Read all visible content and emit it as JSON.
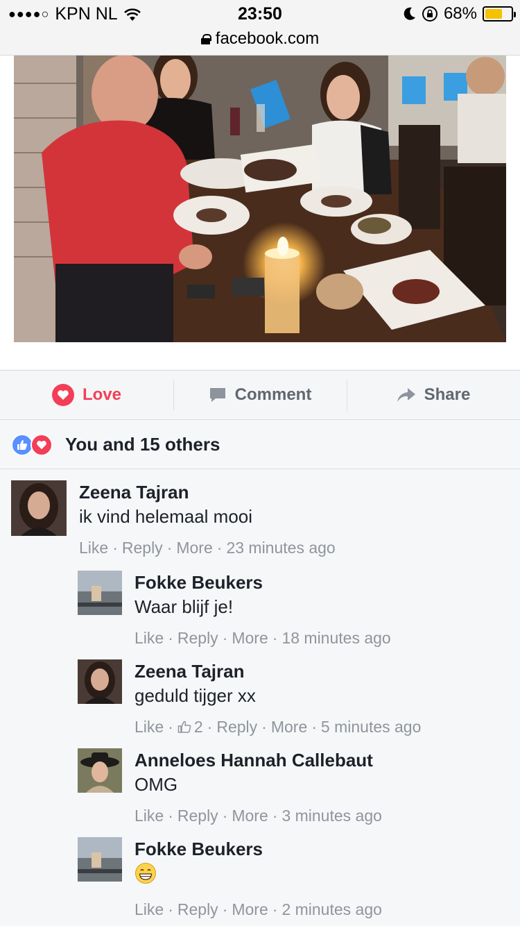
{
  "status_bar": {
    "signal": "●●●●○",
    "carrier": "KPN NL",
    "time": "23:50",
    "battery_percent": "68%",
    "battery_level": 0.68,
    "url": "facebook.com"
  },
  "actions": {
    "love_label": "Love",
    "comment_label": "Comment",
    "share_label": "Share"
  },
  "reactions": {
    "summary": "You and 15 others"
  },
  "comments": [
    {
      "name": "Zeena Tajran",
      "text": "ik vind helemaal mooi",
      "like": "Like",
      "reply": "Reply",
      "more": "More",
      "time": "23 minutes ago"
    },
    {
      "name": "Fokke Beukers",
      "text": "Waar blijf je!",
      "like": "Like",
      "reply": "Reply",
      "more": "More",
      "time": "18 minutes ago"
    },
    {
      "name": "Zeena Tajran",
      "text": "geduld tijger xx",
      "like": "Like",
      "like_count": "2",
      "reply": "Reply",
      "more": "More",
      "time": "5 minutes ago"
    },
    {
      "name": "Anneloes Hannah Callebaut",
      "text": "OMG",
      "like": "Like",
      "reply": "Reply",
      "more": "More",
      "time": "3 minutes ago"
    },
    {
      "name": "Fokke Beukers",
      "text": "",
      "emoji": "grinning-face",
      "like": "Like",
      "reply": "Reply",
      "more": "More",
      "time": "2 minutes ago"
    }
  ],
  "colors": {
    "love": "#f33e58",
    "like_blue": "#5890ff",
    "meta_gray": "#90949c",
    "action_gray": "#606770"
  }
}
